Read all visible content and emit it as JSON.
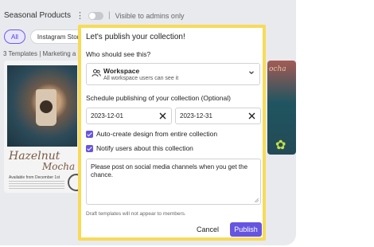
{
  "background": {
    "title": "Seasonal Products",
    "visibility_note": "Visible to admins only",
    "separator": "|",
    "chips": [
      "All",
      "Instagram Story"
    ],
    "template_count": "3 Templates | Marketing a",
    "card": {
      "word1": "Hazelnut",
      "word2": "Mocha",
      "availability": "Available from December 1st"
    },
    "card2_word": "ocha"
  },
  "modal": {
    "title": "Let's publish your collection!",
    "audience_label": "Who should see this?",
    "audience": {
      "selected": "Workspace",
      "description": "All workspace users can see it",
      "icon": "users-icon"
    },
    "schedule_label": "Schedule publishing of your collection (Optional)",
    "start_date": "2023-12-01",
    "end_date": "2023-12-31",
    "options": [
      {
        "label": "Auto-create design from entire collection",
        "checked": true
      },
      {
        "label": "Notify users about this collection",
        "checked": true
      }
    ],
    "message": "Please post on social media channels when you get the chance.",
    "note": "Draft templates will not appear to members.",
    "cancel_label": "Cancel",
    "publish_label": "Publish"
  },
  "colors": {
    "accent": "#6655e0",
    "highlight_border": "#f7db58"
  }
}
